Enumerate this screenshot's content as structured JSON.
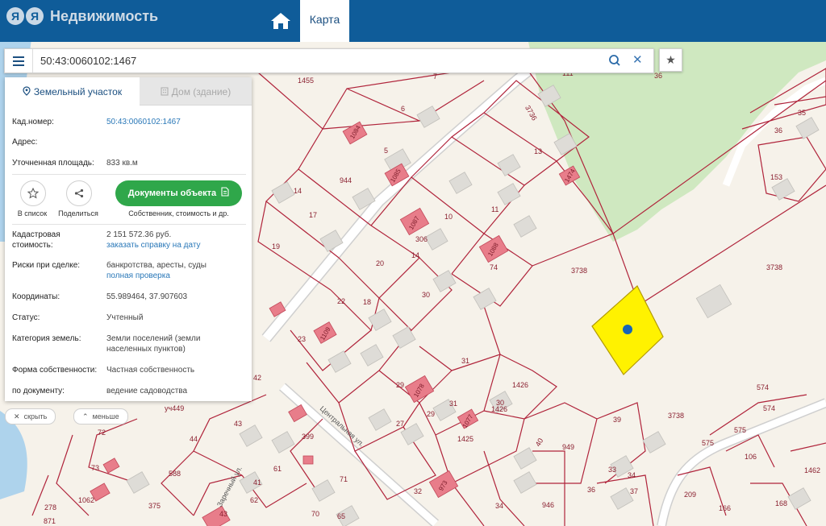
{
  "brand": {
    "logo_letters": [
      "Я",
      "Я"
    ],
    "title": "Недвижимость"
  },
  "nav": {
    "home_icon": "home-icon",
    "map_tab": "Карта"
  },
  "search": {
    "value": "50:43:0060102:1467"
  },
  "panel": {
    "tab_parcel": "Земельный участок",
    "tab_house": "Дом (здание)",
    "cad_label": "Кад.номер:",
    "cad_value": "50:43:0060102:1467",
    "address_label": "Адрес:",
    "area_label": "Уточненная площадь:",
    "area_value": "833 кв.м",
    "to_list": "В список",
    "share": "Поделиться",
    "docs_button": "Документы объекта",
    "docs_sub": "Собственник, стоимость и др.",
    "cost_label_1": "Кадастровая",
    "cost_label_2": "стоимость:",
    "cost_value": "2 151 572.36 руб.",
    "cost_link": "заказать справку на дату",
    "risk_label": "Риски при сделке:",
    "risk_value": "банкротства, аресты, суды",
    "risk_link": "полная проверка",
    "coords_label": "Координаты:",
    "coords_value": "55.989464, 37.907603",
    "status_label": "Статус:",
    "status_value": "Учтенный",
    "category_label": "Категория земель:",
    "category_value_1": "Земли поселений (земли",
    "category_value_2": "населенных пунктов)",
    "ownership_label": "Форма собственности:",
    "ownership_value": "Частная собственность",
    "usage_label": "по документу:",
    "usage_value": "ведение садоводства"
  },
  "pills": {
    "hide": "скрыть",
    "less": "меньше"
  },
  "map_labels": {
    "l1455": "1455",
    "l7": "7",
    "l111": "111",
    "l36a": "36",
    "l35": "35",
    "l36b": "36",
    "l153": "153",
    "l6": "6",
    "l3736": "3736",
    "l13": "13",
    "l5": "5",
    "l944": "944",
    "l14a": "14",
    "l17": "17",
    "l10": "10",
    "l11": "11",
    "l306": "306",
    "l19": "19",
    "l20": "20",
    "l14b": "14",
    "l3738a": "3738",
    "l3738b": "3738",
    "l74": "74",
    "l22": "22",
    "l18": "18",
    "l30": "30",
    "l23": "23",
    "l31a": "31",
    "l42": "42",
    "l29a": "29",
    "l29b": "29",
    "l31b": "31",
    "l30b": "30",
    "l1426a": "1426",
    "l1426b": "1426",
    "l3738c": "3738",
    "l39": "39",
    "l574a": "574",
    "l574b": "574",
    "l43a": "43",
    "l27": "27",
    "l1425": "1425",
    "l40": "40",
    "l949": "949",
    "l575a": "575",
    "l575b": "575",
    "l106": "106",
    "l72": "72",
    "l44": "44",
    "l399": "399",
    "l588": "588",
    "l61": "61",
    "l71": "71",
    "l33": "33",
    "l34a": "34",
    "l1462": "1462",
    "l73": "73",
    "l36c": "36",
    "l37": "37",
    "l209": "209",
    "l1062": "1062",
    "l375": "375",
    "l41": "41",
    "l32": "32",
    "l946": "946",
    "l34b": "34",
    "l166": "166",
    "l278": "278",
    "l871": "871",
    "l43b": "43",
    "l70": "70",
    "l65": "65",
    "l62": "62",
    "l168": "168",
    "l1084": "1084",
    "l1085": "1085",
    "l1087": "1087",
    "l1088": "1088",
    "l1474": "1474",
    "l1109": "1109",
    "l1077": "1077",
    "l1078": "1078",
    "l973": "973",
    "street1": "Центральная ул.",
    "street2": "Заречный ул.",
    "l449": "уч449"
  }
}
